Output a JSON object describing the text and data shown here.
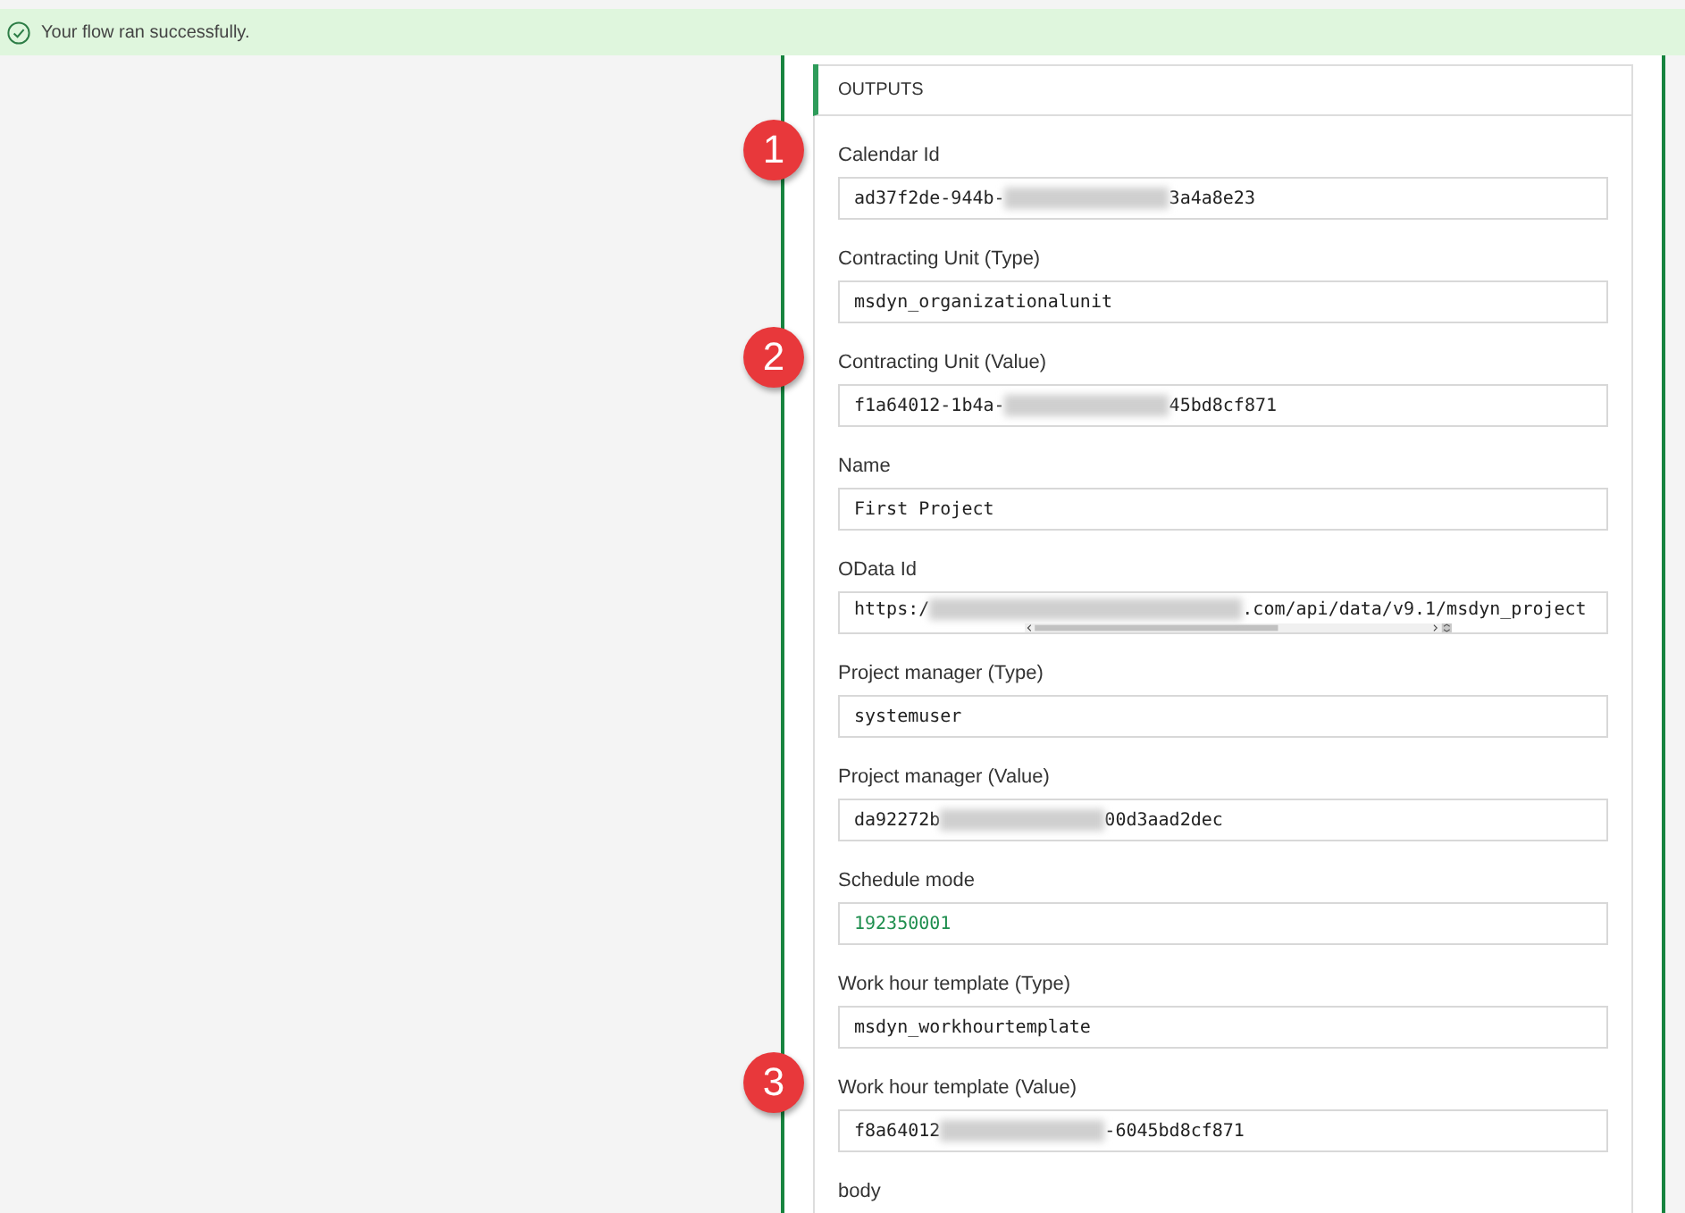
{
  "banner": {
    "message": "Your flow ran successfully."
  },
  "outputs": {
    "title": "OUTPUTS",
    "fields": [
      {
        "label": "Calendar Id",
        "prefix": "ad37f2de-944b-",
        "redacted": true,
        "suffix": "3a4a8e23",
        "kind": "string",
        "callout": "1",
        "scrollable": false
      },
      {
        "label": "Contracting Unit (Type)",
        "prefix": "msdyn_organizationalunit",
        "redacted": false,
        "kind": "string",
        "scrollable": false
      },
      {
        "label": "Contracting Unit (Value)",
        "prefix": "f1a64012-1b4a-",
        "redacted": true,
        "suffix": "45bd8cf871",
        "kind": "string",
        "callout": "2",
        "scrollable": false
      },
      {
        "label": "Name",
        "prefix": "First Project",
        "redacted": false,
        "kind": "string",
        "scrollable": false
      },
      {
        "label": "OData Id",
        "prefix": "https:/",
        "redacted": true,
        "suffix": ".com/api/data/v9.1/msdyn_project",
        "kind": "string",
        "scrollable": true
      },
      {
        "label": "Project manager (Type)",
        "prefix": "systemuser",
        "redacted": false,
        "kind": "string",
        "scrollable": false
      },
      {
        "label": "Project manager (Value)",
        "prefix": "da92272b",
        "redacted": true,
        "suffix": "00d3aad2dec",
        "kind": "string",
        "scrollable": false
      },
      {
        "label": "Schedule mode",
        "prefix": "192350001",
        "redacted": false,
        "kind": "number",
        "scrollable": false
      },
      {
        "label": "Work hour template (Type)",
        "prefix": "msdyn_workhourtemplate",
        "redacted": false,
        "kind": "string",
        "scrollable": false
      },
      {
        "label": "Work hour template (Value)",
        "prefix": "f8a64012",
        "redacted": true,
        "suffix": "-6045bd8cf871",
        "kind": "string",
        "callout": "3",
        "scrollable": false
      }
    ],
    "cut_label": "body"
  }
}
